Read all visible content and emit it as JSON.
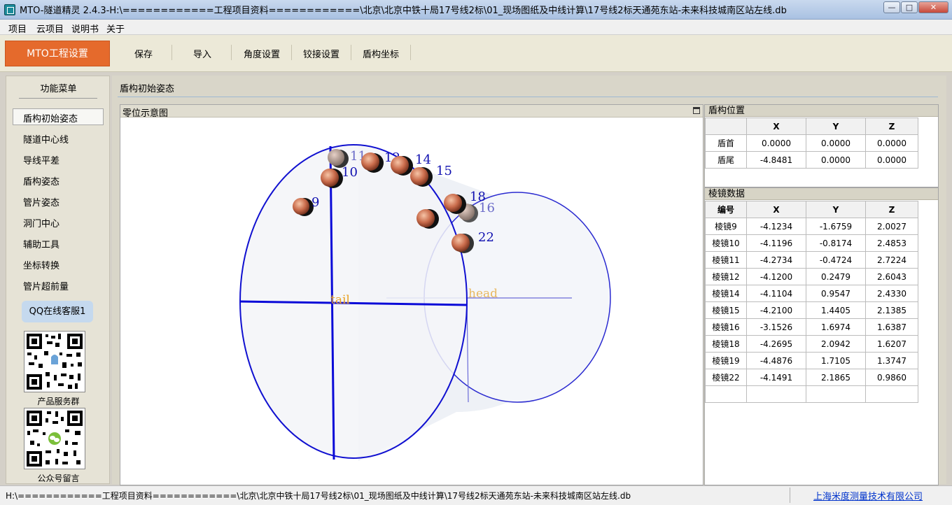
{
  "window": {
    "title": "MTO-隧道精灵 2.4.3-H:\\============工程项目资料============\\北京\\北京中铁十局17号线2标\\01_现场图纸及中线计算\\17号线2标天通苑东站-未来科技城南区站左线.db",
    "minimize": "—",
    "maximize": "□",
    "close": "✕"
  },
  "menu": [
    "项目",
    "云项目",
    "说明书",
    "关于"
  ],
  "toolbar": {
    "primary": "MTO工程设置",
    "buttons": [
      "保存",
      "导入",
      "角度设置",
      "铰接设置",
      "盾构坐标"
    ]
  },
  "sidebar": {
    "title": "功能菜单",
    "items": [
      "盾构初始姿态",
      "隧道中心线",
      "导线平差",
      "盾构姿态",
      "管片姿态",
      "洞门中心",
      "辅助工具",
      "坐标转换",
      "管片超前量"
    ],
    "selected": "盾构初始姿态",
    "qq_button": "QQ在线客服1",
    "qr1_caption": "产品服务群",
    "qr2_caption": "公众号留言"
  },
  "main": {
    "tab": "盾构初始姿态",
    "diagram_title": "零位示意图",
    "diagram_labels": {
      "tail": "tail",
      "head": "head",
      "prisms": [
        "9",
        "10",
        "11",
        "12",
        "14",
        "15",
        "16",
        "18",
        "22"
      ]
    }
  },
  "shield_position": {
    "title": "盾构位置",
    "headers": [
      "",
      "X",
      "Y",
      "Z"
    ],
    "rows": [
      [
        "盾首",
        "0.0000",
        "0.0000",
        "0.0000"
      ],
      [
        "盾尾",
        "-4.8481",
        "0.0000",
        "0.0000"
      ]
    ]
  },
  "prism_data": {
    "title": "棱镜数据",
    "headers": [
      "编号",
      "X",
      "Y",
      "Z"
    ],
    "rows": [
      [
        "棱镜9",
        "-4.1234",
        "-1.6759",
        "2.0027"
      ],
      [
        "棱镜10",
        "-4.1196",
        "-0.8174",
        "2.4853"
      ],
      [
        "棱镜11",
        "-4.2734",
        "-0.4724",
        "2.7224"
      ],
      [
        "棱镜12",
        "-4.1200",
        "0.2479",
        "2.6043"
      ],
      [
        "棱镜14",
        "-4.1104",
        "0.9547",
        "2.4330"
      ],
      [
        "棱镜15",
        "-4.2100",
        "1.4405",
        "2.1385"
      ],
      [
        "棱镜16",
        "-3.1526",
        "1.6974",
        "1.6387"
      ],
      [
        "棱镜18",
        "-4.2695",
        "2.0942",
        "1.6207"
      ],
      [
        "棱镜19",
        "-4.4876",
        "1.7105",
        "1.3747"
      ],
      [
        "棱镜22",
        "-4.1491",
        "2.1865",
        "0.9860"
      ]
    ]
  },
  "statusbar": {
    "path": "H:\\============工程项目资料============\\北京\\北京中铁十局17号线2标\\01_现场图纸及中线计算\\17号线2标天通苑东站-未来科技城南区站左线.db",
    "company": "上海米度测量技术有限公司"
  }
}
